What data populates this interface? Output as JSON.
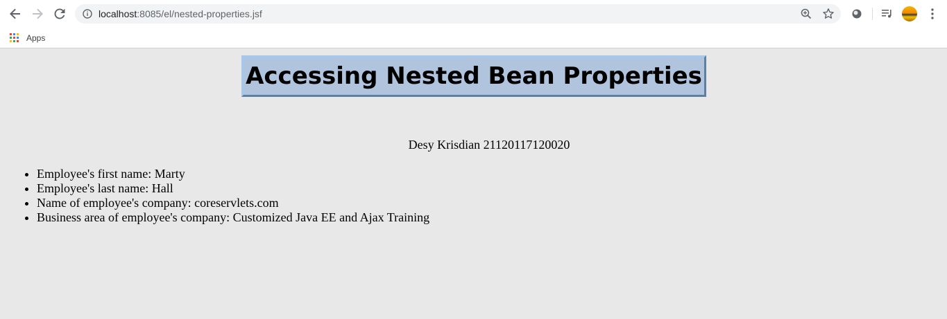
{
  "browser": {
    "url_host": "localhost",
    "url_rest": ":8085/el/nested-properties.jsf",
    "icons": {
      "back": "arrow-left-icon",
      "forward": "arrow-right-icon",
      "reload": "reload-icon",
      "info": "info-icon",
      "zoom": "zoom-in-icon",
      "bookmark": "star-icon",
      "extension": "extension-circle-icon",
      "media": "media-queue-icon",
      "profile": "avatar",
      "menu": "kebab-menu-icon"
    },
    "bookmarks_bar": {
      "apps_label": "Apps"
    }
  },
  "page": {
    "title": "Accessing Nested Bean Properties",
    "author_line": "Desy Krisdian 21120117120020",
    "properties": [
      "Employee's first name: Marty",
      "Employee's last name: Hall",
      "Name of employee's company: coreservlets.com",
      "Business area of employee's company: Customized Java EE and Ajax Training"
    ]
  },
  "colors": {
    "page_background": "#e8e8e8",
    "title_background": "#b0c4de",
    "omnibox_background": "#f1f3f4"
  }
}
